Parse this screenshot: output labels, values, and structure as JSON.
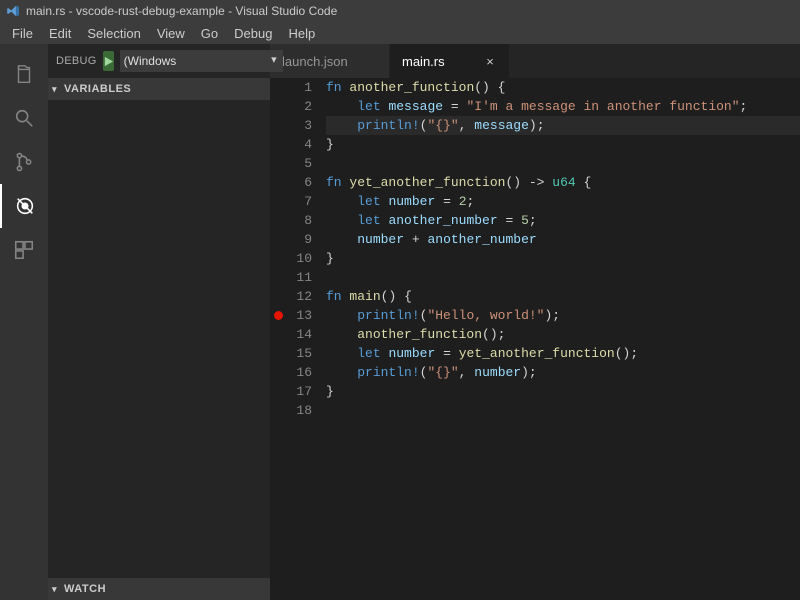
{
  "title": "main.rs - vscode-rust-debug-example - Visual Studio Code",
  "menu": {
    "file": "File",
    "edit": "Edit",
    "selection": "Selection",
    "view": "View",
    "go": "Go",
    "debug": "Debug",
    "help": "Help"
  },
  "sidebar": {
    "debug_label": "DEBUG",
    "config_value": "(Windows",
    "variables_label": "VARIABLES",
    "watch_label": "WATCH"
  },
  "tabs": {
    "launch": "launch.json",
    "main": "main.rs",
    "close_glyph": "×"
  },
  "code_lines": [
    {
      "n": 1,
      "bp": false,
      "html": "<span class='kw'>fn</span> <span class='fn-name'>another_function</span><span class='pn'>()</span> <span class='pn'>{</span>"
    },
    {
      "n": 2,
      "bp": false,
      "html": "    <span class='kw'>let</span> <span class='id'>message</span> <span class='pn'>=</span> <span class='str'>\"I'm a message in another function\"</span><span class='pn'>;</span>"
    },
    {
      "n": 3,
      "bp": false,
      "hl": true,
      "html": "    <span class='mac'>println!</span><span class='pn'>(</span><span class='str'>\"{}\"</span><span class='pn'>,</span> <span class='id'>message</span><span class='pn'>);</span>"
    },
    {
      "n": 4,
      "bp": false,
      "html": "<span class='pn'>}</span>"
    },
    {
      "n": 5,
      "bp": false,
      "html": ""
    },
    {
      "n": 6,
      "bp": false,
      "html": "<span class='kw'>fn</span> <span class='fn-name'>yet_another_function</span><span class='pn'>()</span> <span class='pn'>-&gt;</span> <span class='ty'>u64</span> <span class='pn'>{</span>"
    },
    {
      "n": 7,
      "bp": false,
      "html": "    <span class='kw'>let</span> <span class='id'>number</span> <span class='pn'>=</span> <span class='num-lit'>2</span><span class='pn'>;</span>"
    },
    {
      "n": 8,
      "bp": false,
      "html": "    <span class='kw'>let</span> <span class='id'>another_number</span> <span class='pn'>=</span> <span class='num-lit'>5</span><span class='pn'>;</span>"
    },
    {
      "n": 9,
      "bp": false,
      "html": "    <span class='id'>number</span> <span class='pn'>+</span> <span class='id'>another_number</span>"
    },
    {
      "n": 10,
      "bp": false,
      "html": "<span class='pn'>}</span>"
    },
    {
      "n": 11,
      "bp": false,
      "html": ""
    },
    {
      "n": 12,
      "bp": false,
      "html": "<span class='kw'>fn</span> <span class='fn-name'>main</span><span class='pn'>()</span> <span class='pn'>{</span>"
    },
    {
      "n": 13,
      "bp": true,
      "html": "    <span class='mac'>println!</span><span class='pn'>(</span><span class='str'>\"Hello, world!\"</span><span class='pn'>);</span>"
    },
    {
      "n": 14,
      "bp": false,
      "html": "    <span class='fn-name'>another_function</span><span class='pn'>();</span>"
    },
    {
      "n": 15,
      "bp": false,
      "html": "    <span class='kw'>let</span> <span class='id'>number</span> <span class='pn'>=</span> <span class='fn-name'>yet_another_function</span><span class='pn'>();</span>"
    },
    {
      "n": 16,
      "bp": false,
      "html": "    <span class='mac'>println!</span><span class='pn'>(</span><span class='str'>\"{}\"</span><span class='pn'>,</span> <span class='id'>number</span><span class='pn'>);</span>"
    },
    {
      "n": 17,
      "bp": false,
      "html": "<span class='pn'>}</span>"
    },
    {
      "n": 18,
      "bp": false,
      "html": ""
    }
  ]
}
